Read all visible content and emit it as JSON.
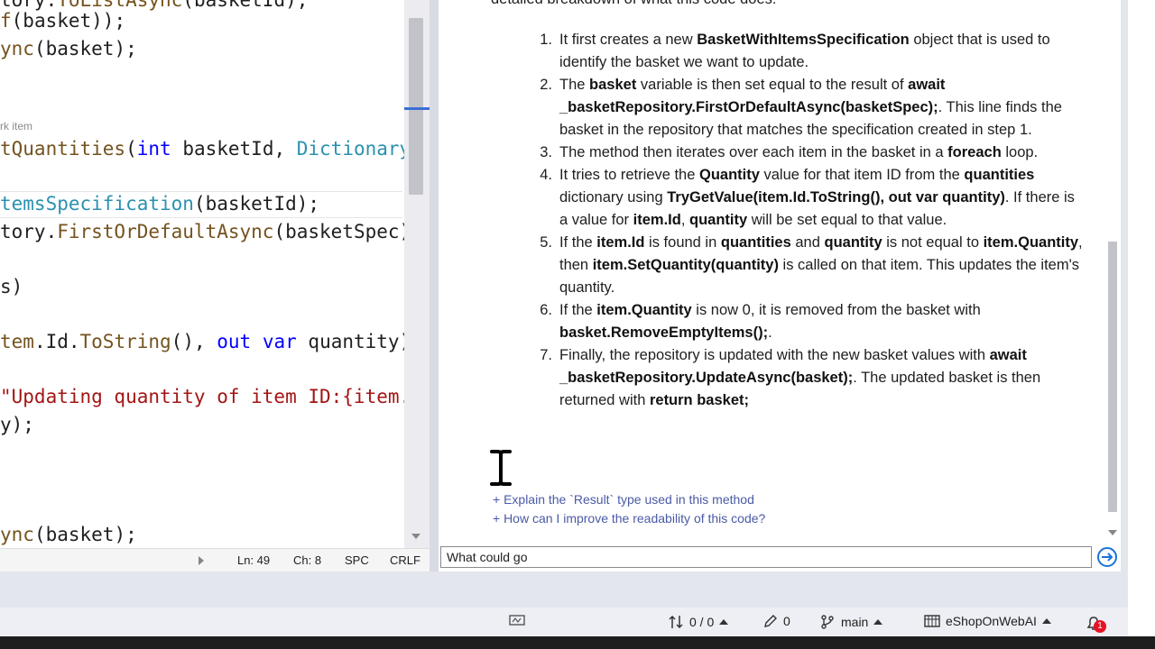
{
  "editor": {
    "codelens": "rk item",
    "status": {
      "line": "Ln: 49",
      "char": "Ch: 8",
      "spacing": "SPC",
      "line_ending": "CRLF"
    }
  },
  "chat": {
    "top_fragment": "detailed breakdown of what this code does:",
    "steps": [
      {
        "number": "1.",
        "line1": "It first creates a new BasketWithItemsSpecification object that is",
        "line2": "used to identify the basket we want to update."
      },
      {
        "number": "2.",
        "text": "The basket variable is then set equal to the result of await _basketRepository.FirstOrDefaultAsync(basketSpec);. This line finds the basket in the repository that matches the specification created in step 1."
      },
      {
        "number": "3.",
        "text": "The method then iterates over each item in the basket in a foreach loop."
      },
      {
        "number": "4.",
        "text": "It tries to retrieve the Quantity value for that item ID from the quantities dictionary using TryGetValue(item.Id.ToString(), out var quantity). If there is a value for item.Id, quantity will be set equal to that value."
      },
      {
        "number": "5.",
        "text": "If the item.Id is found in quantities and quantity is not equal to item.Quantity, then item.SetQuantity(quantity) is called on that item. This updates the item's quantity."
      },
      {
        "number": "6.",
        "text": "If the item.Quantity is now 0, it is removed from the basket with basket.RemoveEmptyItems();."
      },
      {
        "number": "7.",
        "text": "Finally, the repository is updated with the new basket values with await _basketRepository.UpdateAsync(basket);. The updated basket is then returned with return basket;"
      }
    ],
    "suggestions": [
      "+ Explain the `Result` type used in this method",
      "+ How can I improve the readability of this code?"
    ],
    "input_value": "What could go"
  },
  "status_bar": {
    "sync": "0 / 0",
    "pending_changes": "0",
    "branch": "main",
    "repository": "eShopOnWebAI",
    "notification_count": "1"
  },
  "colors": {
    "accent": "#1a73d9",
    "notification": "#e81123"
  }
}
